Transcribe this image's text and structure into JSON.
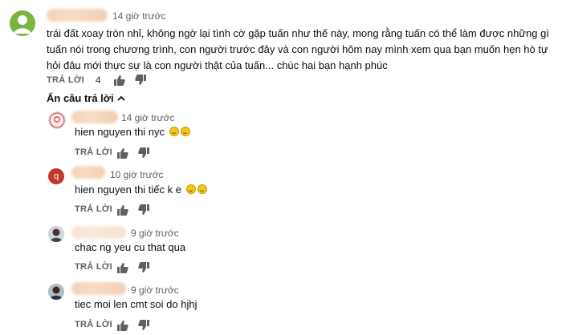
{
  "comment": {
    "time": "14 giờ trước",
    "text": "trái đất xoay tròn nhỉ, không ngờ lại tình cờ gặp tuấn như thế này, mong rằng tuấn có thể làm được những gì tuấn nói trong chương trình, con người trước đây và con người hôm nay mình xem qua bạn muốn hẹn hò tự hỏi đâu mới thực sự là con người thật của tuấn... chúc hai bạn hạnh phúc",
    "reply_label": "TRẢ LỜI",
    "likes": "4"
  },
  "toggle": {
    "label": "Ẩn câu trả lời"
  },
  "replies": [
    {
      "time": "14 giờ trước",
      "text": "hien nguyen thi nyc",
      "reply_label": "TRẢ LỜI"
    },
    {
      "time": "10 giờ trước",
      "text": "hien nguyen thi tiếc k e",
      "reply_label": "TRẢ LỜI",
      "avatar_letter": "q"
    },
    {
      "time": "9 giờ trước",
      "text": "chac ng yeu cu that qua",
      "reply_label": "TRẢ LỜI"
    },
    {
      "time": "9 giờ trước",
      "text": "tiec moi len cmt soi do hjhj",
      "reply_label": "TRẢ LỜI"
    }
  ],
  "colors": {
    "avatar_green": "#7cb342",
    "avatar_red": "#c0392b",
    "text_muted": "#606060"
  },
  "icons": {
    "like": "thumbs-up-icon",
    "dislike": "thumbs-down-icon",
    "collapse": "chevron-up-icon"
  }
}
